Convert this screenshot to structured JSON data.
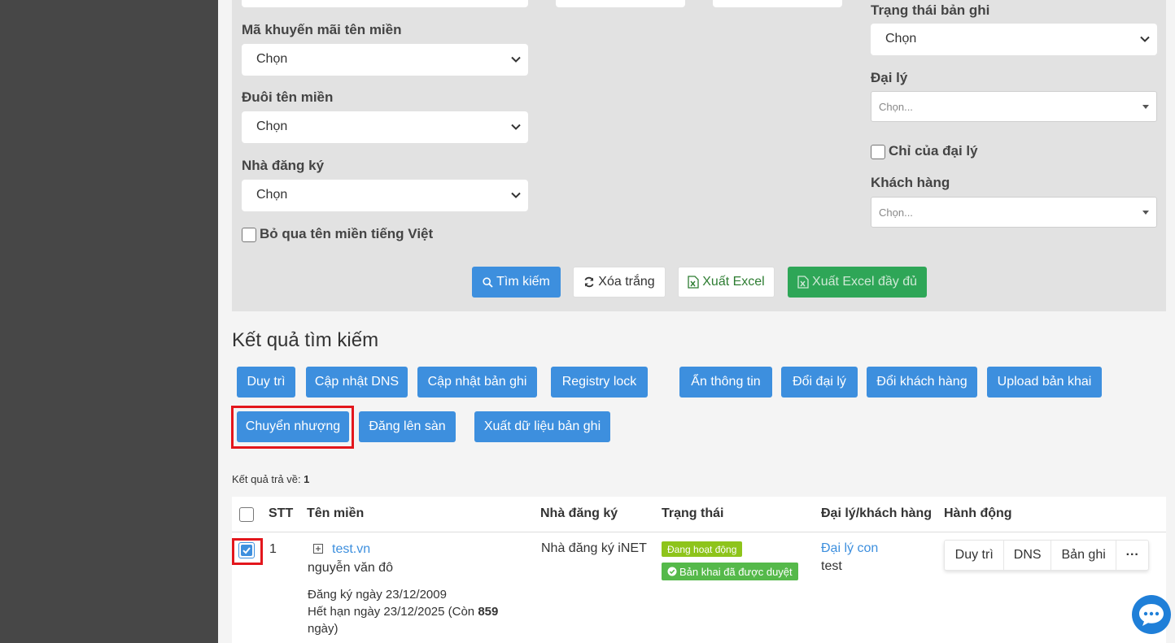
{
  "filters": {
    "promo_label": "Mã khuyến mãi tên miền",
    "promo_value": "Chọn",
    "suffix_label": "Đuôi tên miền",
    "suffix_value": "Chọn",
    "registrar_label": "Nhà đăng ký",
    "registrar_value": "Chọn",
    "skip_vn_label": "Bỏ qua tên miền tiếng Việt",
    "record_status_label": "Trạng thái bản ghi",
    "record_status_value": "Chọn",
    "agent_label": "Đại lý",
    "agent_placeholder": "Chọn...",
    "agent_only_label": "Chỉ của đại lý",
    "customer_label": "Khách hàng",
    "customer_placeholder": "Chọn..."
  },
  "filter_actions": {
    "search": "Tìm kiếm",
    "clear": "Xóa trắng",
    "export_excel": "Xuất Excel",
    "export_excel_full": "Xuất Excel đầy đủ"
  },
  "results": {
    "title": "Kết quả tìm kiếm",
    "count_label": "Kết quả trả về: ",
    "count": "1"
  },
  "bulk_actions": {
    "maintain": "Duy trì",
    "update_dns": "Cập nhật DNS",
    "update_record": "Cập nhật bản ghi",
    "registry_lock": "Registry lock",
    "hide_info": "Ẩn thông tin",
    "change_agent": "Đổi đại lý",
    "change_customer": "Đổi khách hàng",
    "upload_declaration": "Upload bản khai",
    "transfer": "Chuyển nhượng",
    "list_marketplace": "Đăng lên sàn",
    "export_records": "Xuất dữ liệu bản ghi"
  },
  "table": {
    "headers": {
      "stt": "STT",
      "domain": "Tên miền",
      "registrar": "Nhà đăng ký",
      "status": "Trạng thái",
      "agent_customer": "Đại lý/khách hàng",
      "actions": "Hành động"
    },
    "rows": [
      {
        "stt": "1",
        "domain": "test.vn",
        "owner": "nguyễn văn đô",
        "registered": "Đăng ký ngày 23/12/2009",
        "expires_prefix": "Hết hạn ngày 23/12/2025 (Còn ",
        "days_left": "859",
        "days_suffix": "ngày)",
        "registrar": "Nhà đăng ký iNET",
        "status_active": "Đang hoạt động",
        "status_approved": "Bản khai đã được duyệt",
        "agent": "Đại lý con",
        "customer": "test",
        "action_maintain": "Duy trì",
        "action_dns": "DNS",
        "action_record": "Bản ghi",
        "action_more": "···"
      }
    ]
  },
  "colors": {
    "primary": "#3d8fde",
    "success": "#2ea657",
    "badge_active": "#8ec41b",
    "badge_approved": "#55b94a",
    "highlight": "#e3161c",
    "sidebar": "#474747"
  }
}
